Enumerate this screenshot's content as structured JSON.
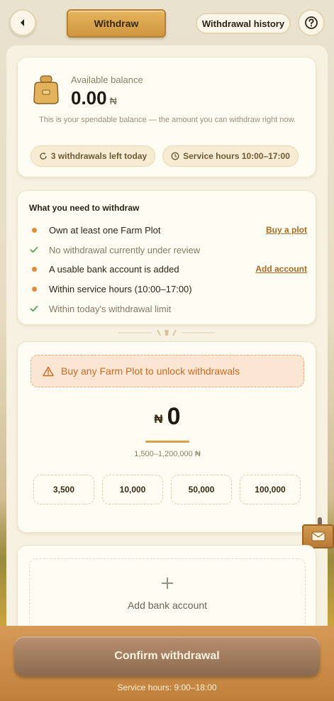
{
  "header": {
    "title": "Withdraw",
    "history_label": "Withdrawal history",
    "back_icon": "chevron-left-icon",
    "help_icon": "question-circle-icon"
  },
  "balance": {
    "label": "Available balance",
    "value": "0.00",
    "currency": "₦",
    "description": "This is your spendable balance — the amount you can withdraw right now.",
    "withdrawals_left": "3 withdrawals left today",
    "service_hours": "Service hours 10:00–17:00"
  },
  "requirements": {
    "title": "What you need to withdraw",
    "items": [
      {
        "text": "Own at least one Farm Plot",
        "met": false,
        "link": "Buy a plot"
      },
      {
        "text": "No withdrawal currently under review",
        "met": true,
        "link": ""
      },
      {
        "text": "A usable bank account is added",
        "met": false,
        "link": "Add account"
      },
      {
        "text": "Within service hours (10:00–17:00)",
        "met": false,
        "link": ""
      },
      {
        "text": "Within today's withdrawal limit",
        "met": true,
        "link": ""
      }
    ]
  },
  "amount": {
    "warning": "Buy any Farm Plot to unlock withdrawals",
    "currency": "₦",
    "value": "0",
    "range": "1,500–1,200,000 ₦",
    "presets": [
      "3,500",
      "10,000",
      "50,000",
      "100,000"
    ]
  },
  "bank": {
    "add_label": "Add bank account"
  },
  "footer": {
    "confirm_label": "Confirm withdrawal",
    "service_note": "Service hours: 9:00–18:00"
  },
  "colors": {
    "accent": "#d7a24d",
    "warning": "#c96b24",
    "pending_dot": "#e08a3a",
    "success_check": "#5aa05a",
    "button": "#8b6a4f"
  }
}
